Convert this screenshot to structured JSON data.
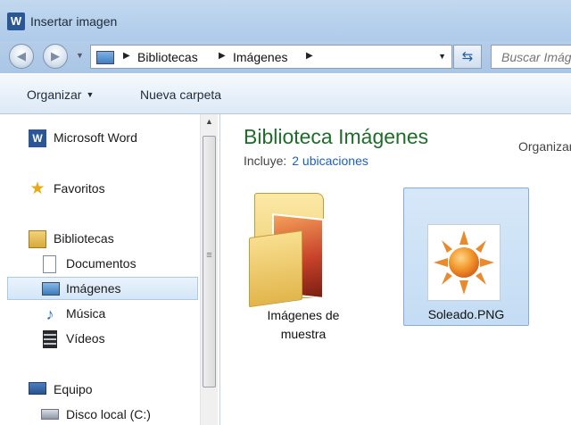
{
  "window": {
    "title": "Insertar imagen"
  },
  "address": {
    "crumbs": [
      "Bibliotecas",
      "Imágenes"
    ]
  },
  "search": {
    "placeholder": "Buscar Imágenes"
  },
  "toolbar": {
    "organize": "Organizar",
    "new_folder": "Nueva carpeta"
  },
  "nav": {
    "items": [
      {
        "label": "Microsoft Word",
        "icon": "word-icon"
      },
      {
        "label": "Favoritos",
        "icon": "star-icon"
      },
      {
        "label": "Bibliotecas",
        "icon": "library-icon"
      },
      {
        "label": "Documentos",
        "icon": "document-icon"
      },
      {
        "label": "Imágenes",
        "icon": "pictures-icon",
        "selected": true
      },
      {
        "label": "Música",
        "icon": "music-icon"
      },
      {
        "label": "Vídeos",
        "icon": "video-icon"
      },
      {
        "label": "Equipo",
        "icon": "computer-icon"
      },
      {
        "label": "Disco local (C:)",
        "icon": "hard-disk-icon"
      }
    ]
  },
  "content": {
    "title": "Biblioteca Imágenes",
    "includes_label": "Incluye:",
    "includes_link": "2 ubicaciones",
    "arrange_label": "Organizar por:",
    "items": [
      {
        "name_line1": "Imágenes de",
        "name_line2": "muestra",
        "type": "folder"
      },
      {
        "name": "Soleado.PNG",
        "type": "image",
        "selected": true
      }
    ]
  },
  "colors": {
    "accent_title": "#1e6d29",
    "link": "#1a60c2",
    "selection": "#c4dcf4"
  }
}
